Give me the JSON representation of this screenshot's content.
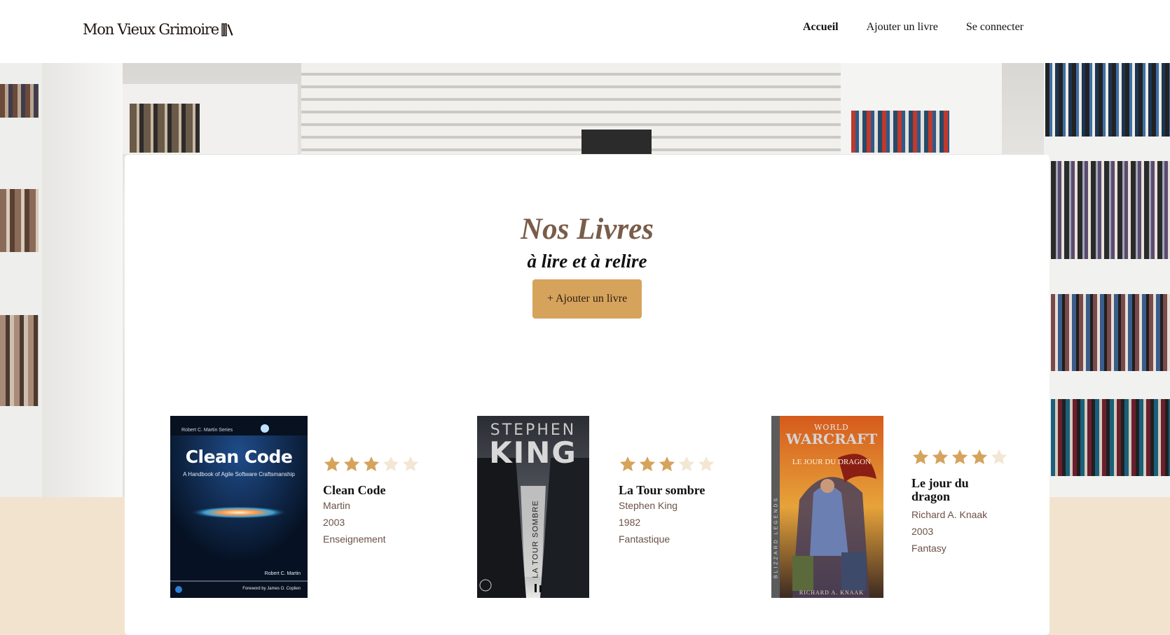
{
  "header": {
    "logo": "Mon Vieux Grimoire",
    "nav": [
      {
        "label": "Accueil",
        "active": true
      },
      {
        "label": "Ajouter un livre",
        "active": false
      },
      {
        "label": "Se connecter",
        "active": false
      }
    ]
  },
  "hero": {
    "title": "Nos Livres",
    "subtitle": "à lire et à relire",
    "add_button": "+ Ajouter un livre"
  },
  "books": [
    {
      "title": "Clean Code",
      "author": "Martin",
      "year": "2003",
      "genre": "Enseignement",
      "rating": 3,
      "cover": {
        "series": "Robert C. Martin Series",
        "title": "Clean Code",
        "subtitle": "A Handbook of Agile Software Craftsmanship",
        "author": "Robert C. Martin",
        "foreword": "Foreword by James O. Coplien"
      }
    },
    {
      "title": "La Tour sombre",
      "author": "Stephen King",
      "year": "1982",
      "genre": "Fantastique",
      "rating": 3,
      "cover": {
        "top": "STEPHEN",
        "main": "KING",
        "spine": "LA TOUR SOMBRE"
      }
    },
    {
      "title": "Le jour du dragon",
      "author": "Richard A. Knaak",
      "year": "2003",
      "genre": "Fantasy",
      "rating": 4,
      "cover": {
        "brand_top": "WORLD",
        "brand_main": "WARCRAFT",
        "title": "LE JOUR DU DRAGON",
        "side": "BLIZZARD LEGENDS",
        "author": "RICHARD A. KNAAK"
      }
    }
  ],
  "colors": {
    "accent": "#d6a35c",
    "star_full": "#d6a35c",
    "star_empty": "#f3e6d3",
    "page_bg": "#f2e3cf",
    "meta_text": "#6b5147"
  },
  "icons": {
    "logo_icon": "books-icon",
    "rating_icon": "star-icon"
  }
}
